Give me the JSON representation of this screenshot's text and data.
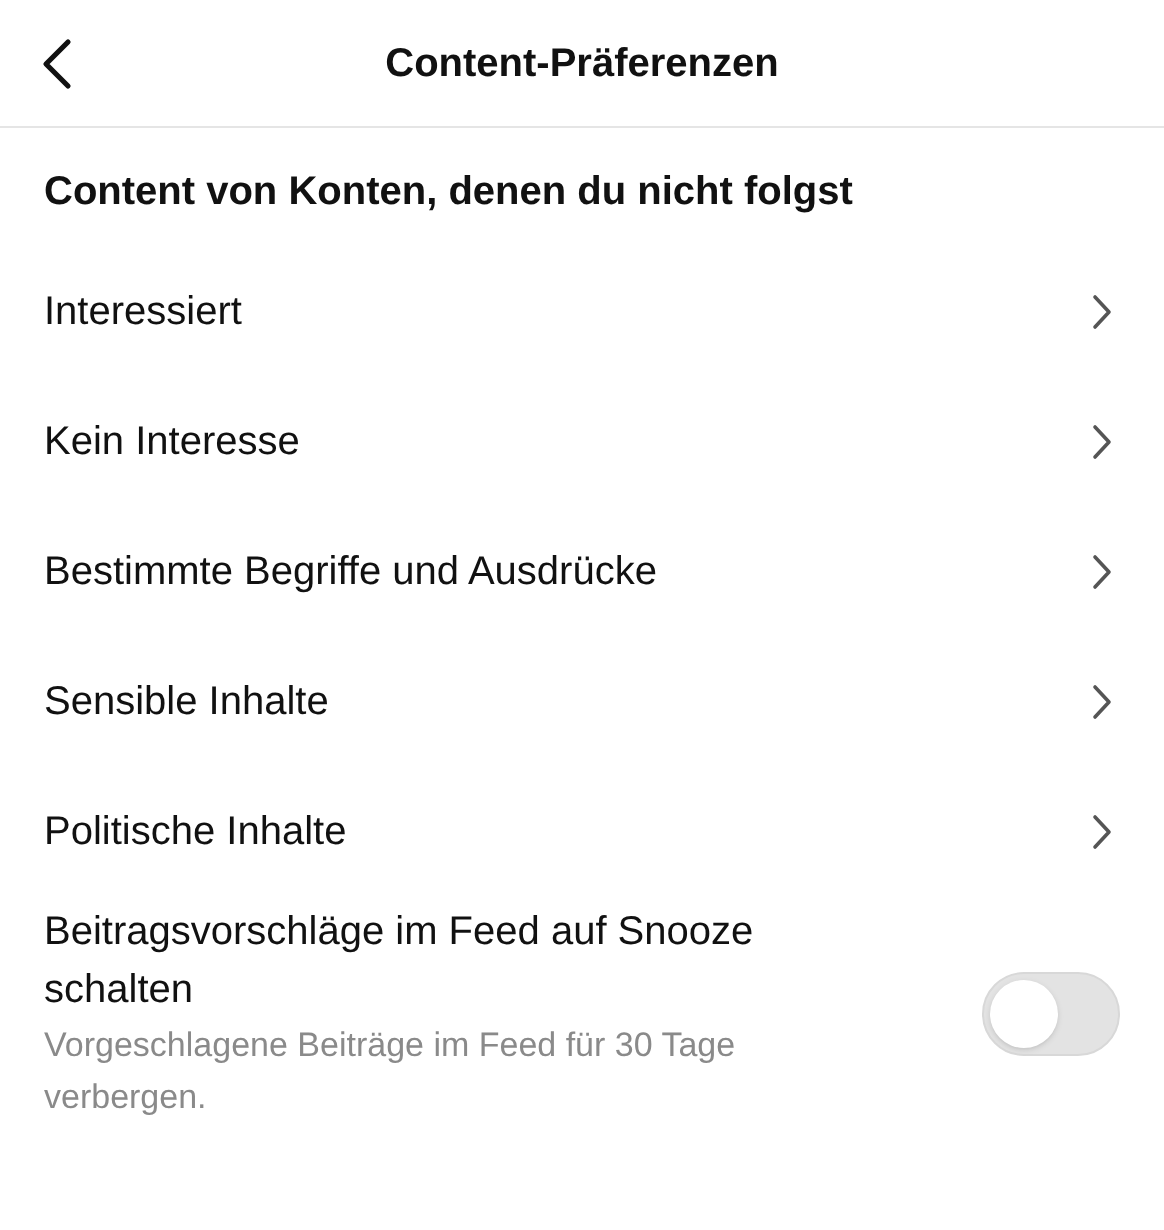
{
  "header": {
    "title": "Content-Präferenzen"
  },
  "section": {
    "title": "Content von Konten, denen du nicht folgst"
  },
  "items": [
    {
      "label": "Interessiert"
    },
    {
      "label": "Kein Interesse"
    },
    {
      "label": "Bestimmte Begriffe und Ausdrücke"
    },
    {
      "label": "Sensible Inhalte"
    },
    {
      "label": "Politische Inhalte"
    }
  ],
  "snooze": {
    "title": "Beitragsvorschläge im Feed auf Snooze schalten",
    "description": "Vorgeschlagene Beiträge im Feed für 30 Tage verbergen.",
    "on": false
  }
}
